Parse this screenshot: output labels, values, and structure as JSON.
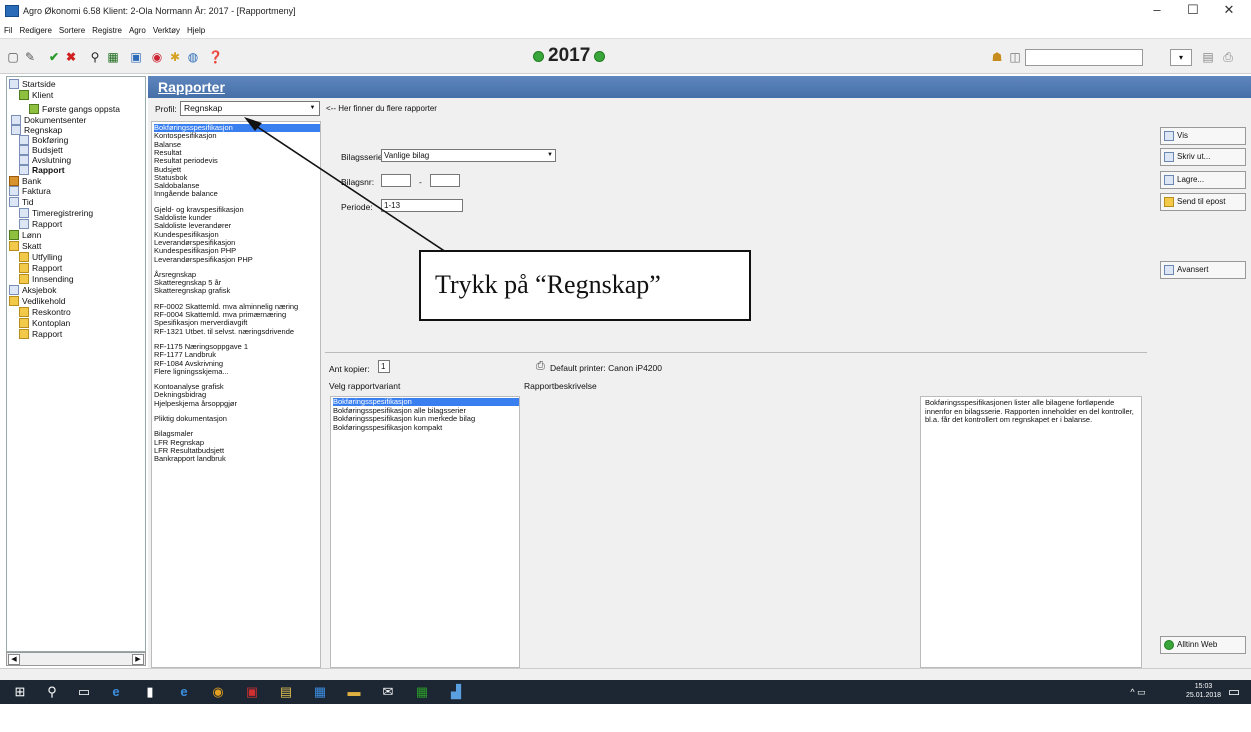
{
  "window": {
    "title": "Agro Økonomi 6.58     Klient: 2-Ola Normann    År: 2017 - [Rapportmeny]",
    "minimize": "–",
    "maximize": "☐",
    "close": "✕"
  },
  "menu": [
    "Fil",
    "Redigere",
    "Sortere",
    "Registre",
    "Agro",
    "Verktøy",
    "Hjelp"
  ],
  "toolbar": {
    "year": "2017"
  },
  "tree": [
    {
      "label": "Startside",
      "icon": "home-icon"
    },
    {
      "label": "Klient",
      "icon": "people-icon"
    },
    {
      "label": "Første gangs oppsta",
      "icon": "people-icon"
    },
    {
      "label": "Dokumentsenter",
      "icon": "document-icon"
    },
    {
      "label": "Regnskap",
      "icon": "document-icon"
    },
    {
      "label": "Bokføring",
      "icon": "document-icon"
    },
    {
      "label": "Budsjett",
      "icon": "document-icon"
    },
    {
      "label": "Avslutning",
      "icon": "document-icon"
    },
    {
      "label": "Rapport",
      "icon": "document-icon"
    },
    {
      "label": "Bank",
      "icon": "bank-icon"
    },
    {
      "label": "Faktura",
      "icon": "document-icon"
    },
    {
      "label": "Tid",
      "icon": "document-icon"
    },
    {
      "label": "Timeregistrering",
      "icon": "document-icon"
    },
    {
      "label": "Rapport",
      "icon": "document-icon"
    },
    {
      "label": "Lønn",
      "icon": "money-icon"
    },
    {
      "label": "Skatt",
      "icon": "folder-icon"
    },
    {
      "label": "Utfylling",
      "icon": "folder-icon"
    },
    {
      "label": "Rapport",
      "icon": "folder-icon"
    },
    {
      "label": "Innsending",
      "icon": "folder-icon"
    },
    {
      "label": "Aksjebok",
      "icon": "document-icon"
    },
    {
      "label": "Vedlikehold",
      "icon": "folder-icon"
    },
    {
      "label": "Reskontro",
      "icon": "folder-icon"
    },
    {
      "label": "Kontoplan",
      "icon": "folder-icon"
    },
    {
      "label": "Rapport",
      "icon": "folder-icon"
    }
  ],
  "main": {
    "header": "Rapporter",
    "profil_label": "Profil:",
    "profil_value": "Regnskap",
    "profil_hint": "<-- Her finner du flere rapporter",
    "reports": [
      "Bokføringsspesifikasjon",
      "Kontospesifikasjon",
      "Balanse",
      "Resultat",
      "Resultat periodevis",
      "Budsjett",
      "Statusbok",
      "Saldobalanse",
      "Inngående balance",
      "",
      "Gjeld- og kravspesifikasjon",
      "Saldoliste kunder",
      "Saldoliste leverandører",
      "Kundespesifikasjon",
      "Leverandørspesifikasjon",
      "Kundespesifikasjon PHP",
      "Leverandørspesifikasjon PHP",
      "",
      "Årsregnskap",
      "Skatteregnskap 5 år",
      "Skatteregnskap grafisk",
      "",
      "RF-0002 Skattemld. mva alminnelig næring",
      "RF-0004 Skattemld. mva primærnæring",
      "Spesifikasjon merverdiavgift",
      "RF-1321 Utbet. til selvst. næringsdrivende",
      "",
      "RF-1175 Næringsoppgave 1",
      "RF-1177 Landbruk",
      "RF-1084 Avskrivning",
      "Flere ligningsskjema...",
      "",
      "Kontoanalyse grafisk",
      "Dekningsbidrag",
      "Hjelpeskjema årsoppgjør",
      "",
      "Pliktig dokumentasjon",
      "",
      "Bilagsmaler",
      "LFR Regnskap",
      "LFR Resultatbudsjett",
      "Bankrapport landbruk"
    ],
    "bilagsserie_label": "Bilagsserie:",
    "bilagsserie_value": "Vanlige bilag",
    "bilagsnr_label": "Bilagsnr:",
    "bilagsnr_sep": "-",
    "periode_label": "Periode:",
    "periode_value": "1-13",
    "callout": "Trykk på “Regnskap”",
    "antall_label": "Ant kopier:",
    "antall_value": "1",
    "printer": "Default printer: Canon iP4200",
    "velg_label": "Velg rapportvariant",
    "beskrivelse_label": "Rapportbeskrivelse",
    "variants": [
      "Bokføringsspesifikasjon",
      "Bokføringsspesifikasjon alle bilagsserier",
      "Bokføringsspesifikasjon kun merkede bilag",
      "Bokføringsspesifikasjon kompakt"
    ],
    "description": "Bokføringsspesifikasjonen lister alle bilagene fortløpende innenfor en bilagsserie. Rapporten inneholder en del kontroller, bl.a. får det kontrollert om regnskapet er i balanse."
  },
  "buttons": {
    "vis": "Vis",
    "skriv": "Skriv ut...",
    "lagre": "Lagre...",
    "send": "Send til epost",
    "avansert": "Avansert",
    "web": "Alltinn Web"
  },
  "clock": {
    "time": "15:03",
    "date": "25.01.2018"
  }
}
